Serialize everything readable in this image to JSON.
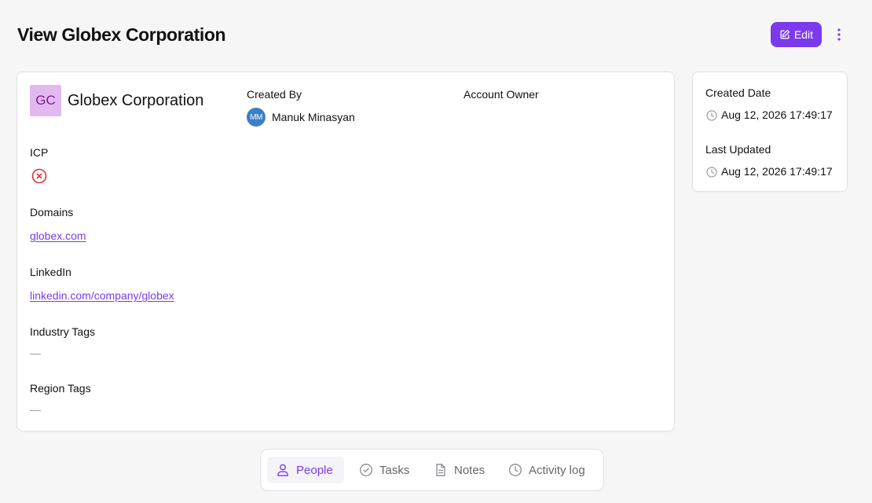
{
  "page": {
    "title": "View Globex Corporation"
  },
  "toolbar": {
    "edit_label": "Edit"
  },
  "company": {
    "initials": "GC",
    "name": "Globex Corporation",
    "created_by_label": "Created By",
    "created_by": {
      "initials": "MM",
      "name": "Manuk Minasyan"
    },
    "account_owner_label": "Account Owner",
    "icp_label": "ICP",
    "domains_label": "Domains",
    "domain": "globex.com",
    "linkedin_label": "LinkedIn",
    "linkedin": "linkedin.com/company/globex",
    "industry_tags_label": "Industry Tags",
    "industry_tags_value": "—",
    "region_tags_label": "Region Tags",
    "region_tags_value": "—"
  },
  "meta": {
    "created_date_label": "Created Date",
    "created_date": "Aug 12, 2026 17:49:17",
    "last_updated_label": "Last Updated",
    "last_updated": "Aug 12, 2026 17:49:17"
  },
  "tabs": [
    {
      "label": "People",
      "icon": "person-icon",
      "active": true
    },
    {
      "label": "Tasks",
      "icon": "check-circle-icon",
      "active": false
    },
    {
      "label": "Notes",
      "icon": "document-icon",
      "active": false
    },
    {
      "label": "Activity log",
      "icon": "clock-icon",
      "active": false
    }
  ],
  "colors": {
    "accent": "#7c3aed",
    "avatar_bg": "#e2b8f0",
    "user_avatar_bg": "#3d7fc7",
    "icp_negative": "#e0323c"
  }
}
